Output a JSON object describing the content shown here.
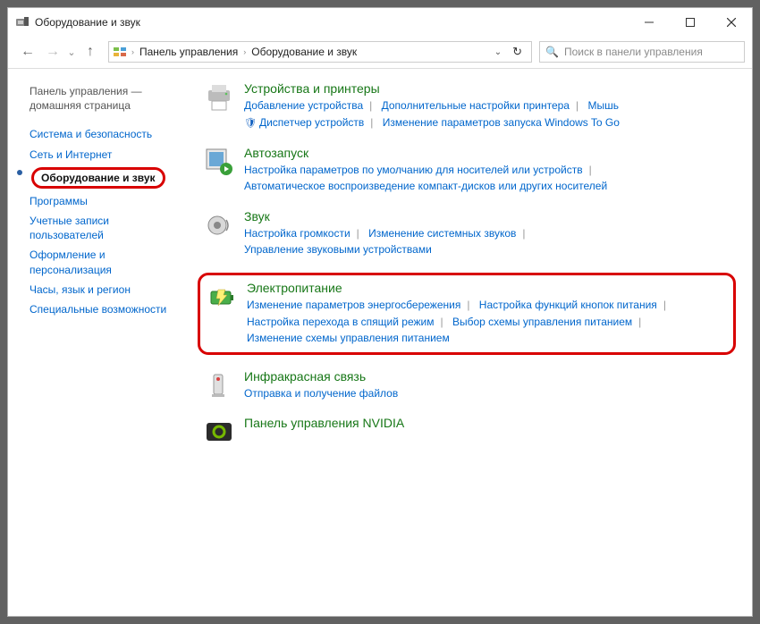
{
  "title": "Оборудование и звук",
  "breadcrumb": {
    "root": "Панель управления",
    "current": "Оборудование и звук"
  },
  "search": {
    "placeholder": "Поиск в панели управления"
  },
  "sidebar": {
    "items": [
      "Панель управления — домашняя страница",
      "Система и безопасность",
      "Сеть и Интернет",
      "Оборудование и звук",
      "Программы",
      "Учетные записи пользователей",
      "Оформление и персонализация",
      "Часы, язык и регион",
      "Специальные возможности"
    ]
  },
  "sections": {
    "devices": {
      "title": "Устройства и принтеры",
      "links": {
        "l0": "Добавление устройства",
        "l1": "Дополнительные настройки принтера",
        "l2": "Мышь",
        "l3": "Диспетчер устройств",
        "l4": "Изменение параметров запуска Windows To Go"
      }
    },
    "autoplay": {
      "title": "Автозапуск",
      "links": {
        "l0": "Настройка параметров по умолчанию для носителей или устройств",
        "l1": "Автоматическое воспроизведение компакт-дисков или других носителей"
      }
    },
    "sound": {
      "title": "Звук",
      "links": {
        "l0": "Настройка громкости",
        "l1": "Изменение системных звуков",
        "l2": "Управление звуковыми устройствами"
      }
    },
    "power": {
      "title": "Электропитание",
      "links": {
        "l0": "Изменение параметров энергосбережения",
        "l1": "Настройка функций кнопок питания",
        "l2": "Настройка перехода в спящий режим",
        "l3": "Выбор схемы управления питанием",
        "l4": "Изменение схемы управления питанием"
      }
    },
    "ir": {
      "title": "Инфракрасная связь",
      "links": {
        "l0": "Отправка и получение файлов"
      }
    },
    "nvidia": {
      "title": "Панель управления NVIDIA"
    }
  }
}
